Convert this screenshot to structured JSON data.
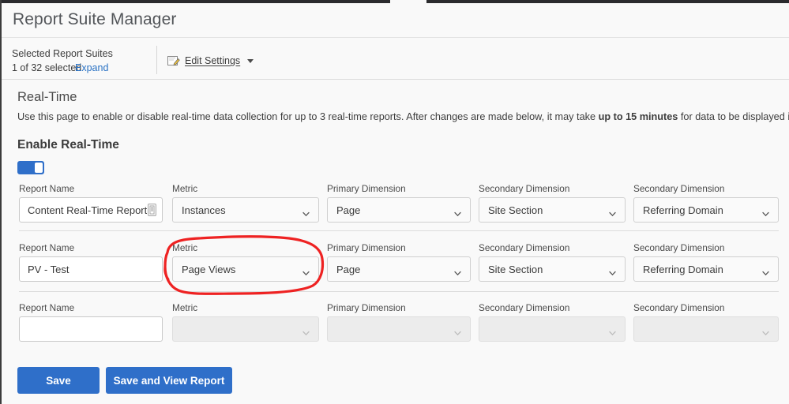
{
  "window": {
    "title": "Report Suite Manager"
  },
  "suites_bar": {
    "label": "Selected Report Suites",
    "count_text": "1 of 32 selected",
    "expand_link": "Expand",
    "edit_settings_label": "Edit Settings",
    "edit_icon": "edit-pencil-icon",
    "caret_icon": "caret-down-icon"
  },
  "section": {
    "title": "Real-Time",
    "desc_part1": "Use this page to enable or disable real-time data collection for up to 3 real-time reports. After changes are made below, it may take ",
    "desc_bold": "up to 15 minutes",
    "desc_part2": " for data to be displayed in the real-time reports.",
    "subsection_title": "Enable Real-Time",
    "toggle_state": "on"
  },
  "labels": {
    "report_name": "Report Name",
    "metric": "Metric",
    "primary_dimension": "Primary Dimension",
    "secondary_dimension": "Secondary Dimension"
  },
  "rows": [
    {
      "report_name_value": "Content Real-Time Report",
      "report_name_placeholder": "",
      "metric_value": "Instances",
      "primary_dimension_value": "Page",
      "secondary_dimension_1_value": "Site Section",
      "secondary_dimension_2_value": "Referring Domain",
      "has_stepper_icon": true,
      "disabled": false
    },
    {
      "report_name_value": "PV - Test",
      "report_name_placeholder": "",
      "metric_value": "Page Views",
      "primary_dimension_value": "Page",
      "secondary_dimension_1_value": "Site Section",
      "secondary_dimension_2_value": "Referring Domain",
      "has_stepper_icon": false,
      "disabled": false
    },
    {
      "report_name_value": "",
      "report_name_placeholder": "",
      "metric_value": "",
      "primary_dimension_value": "",
      "secondary_dimension_1_value": "",
      "secondary_dimension_2_value": "",
      "has_stepper_icon": false,
      "disabled": true
    }
  ],
  "buttons": {
    "save": "Save",
    "save_and_view": "Save and View Report"
  },
  "annotation": {
    "type": "hand-drawn-red-circle",
    "target": "metric-select-row-2",
    "color": "#ee2222"
  },
  "colors": {
    "accent_blue": "#2f6fc9",
    "link_blue": "#2a72c4",
    "annotation_red": "#ee2222",
    "page_bg": "#f9f9f9",
    "border": "#c9c9c9"
  }
}
